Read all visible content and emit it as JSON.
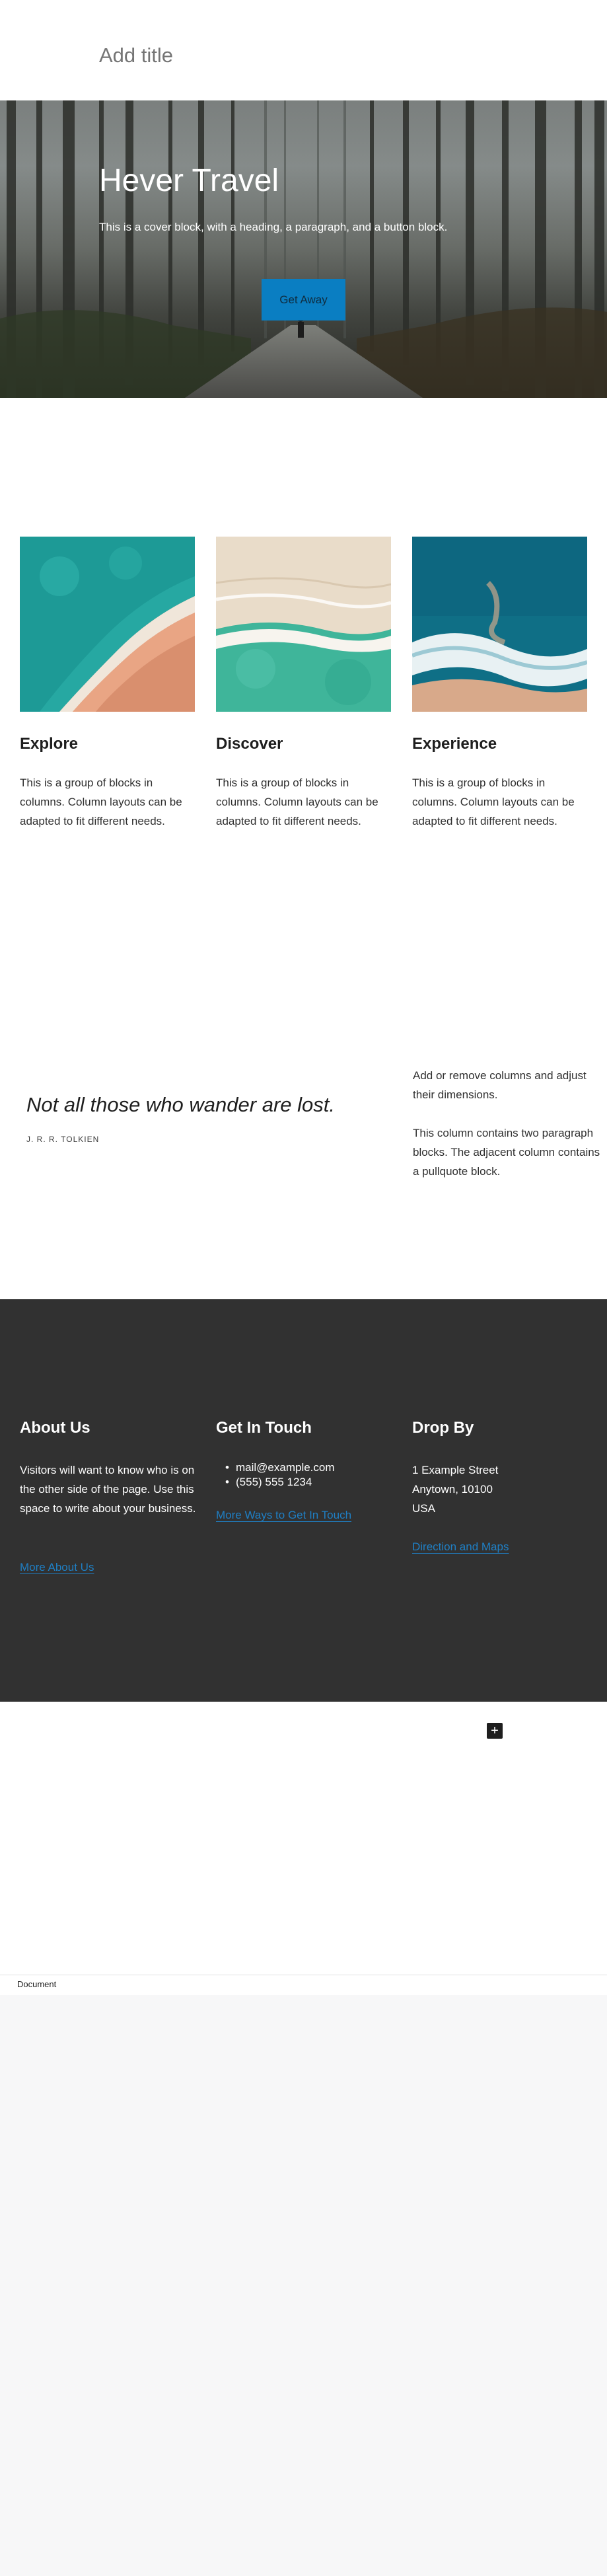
{
  "editor": {
    "title_placeholder": "Add title",
    "breadcrumb": "Document",
    "add_block_icon": "plus-icon"
  },
  "cover": {
    "heading": "Hever Travel",
    "paragraph": "This is a cover block, with a heading, a paragraph, and a button block.",
    "button_label": "Get Away"
  },
  "columns": [
    {
      "heading": "Explore",
      "text": "This is a group of blocks in columns. Column layouts can be adapted to fit different needs."
    },
    {
      "heading": "Discover",
      "text": "This is a group of blocks in columns. Column layouts can be adapted to fit different needs."
    },
    {
      "heading": "Experience",
      "text": "This is a group of blocks in columns. Column layouts can be adapted to fit different needs."
    }
  ],
  "pullquote": {
    "quote": "Not all those who wander are lost.",
    "citation": "J. R. R. TOLKIEN",
    "side_paragraphs": [
      "Add or remove columns and adjust their dimensions.",
      "This column contains two paragraph blocks. The adjacent column contains a pullquote block."
    ]
  },
  "footer": {
    "about": {
      "heading": "About Us",
      "text": "Visitors will want to know who is on the other side of the page. Use this space to write about your business.",
      "link": "More About Us"
    },
    "contact": {
      "heading": "Get In Touch",
      "items": [
        "mail@example.com",
        "(555) 555 1234"
      ],
      "link": "More Ways to Get In Touch"
    },
    "location": {
      "heading": "Drop By",
      "address": [
        "1 Example Street",
        "Anytown, 10100",
        "USA"
      ],
      "link": "Direction and Maps"
    }
  },
  "colors": {
    "button": "#0a7ec2",
    "link": "#1f7fc4",
    "footer_bg": "#313131"
  }
}
